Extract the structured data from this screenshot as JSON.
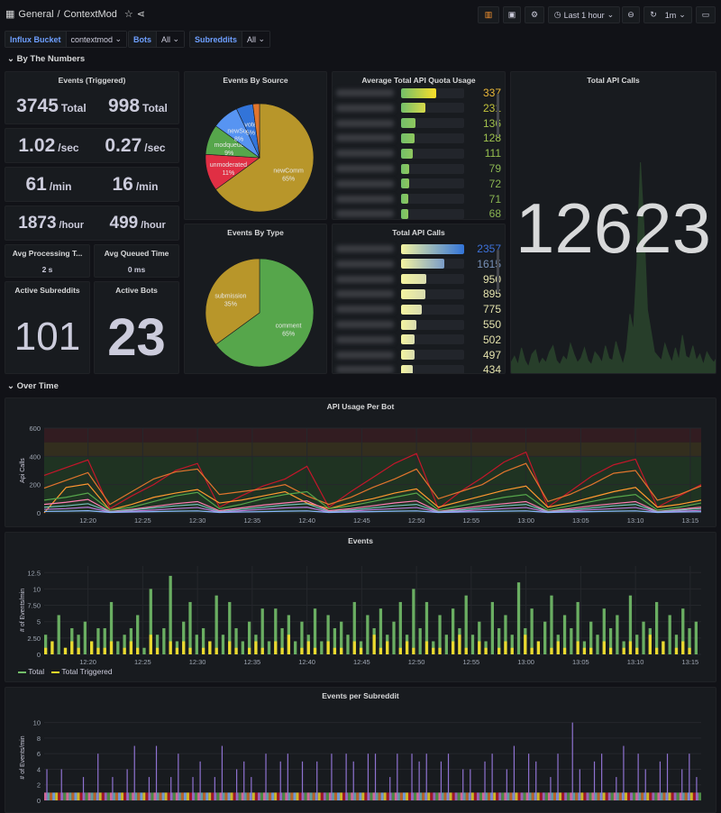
{
  "header": {
    "breadcrumb_folder": "General",
    "breadcrumb_sep": "/",
    "dashboard_title": "ContextMod",
    "time_range": "Last 1 hour",
    "refresh": "1m",
    "icons": [
      "apps-icon",
      "star-icon",
      "share-icon",
      "add-panel-icon",
      "save-icon",
      "settings-icon",
      "clock-icon",
      "zoom-out-icon",
      "refresh-icon",
      "tv-mode-icon"
    ]
  },
  "variables": [
    {
      "label": "Influx Bucket",
      "value": "contextmod"
    },
    {
      "label": "Bots",
      "value": "All"
    },
    {
      "label": "Subreddits",
      "value": "All"
    }
  ],
  "rows": {
    "numbers": "By The Numbers",
    "over_time": "Over Time"
  },
  "stats": {
    "events_title": "Events (Triggered)",
    "lines": [
      {
        "a": "3745",
        "au": "Total",
        "b": "998",
        "bu": "Total"
      },
      {
        "a": "1.02",
        "au": "/sec",
        "b": "0.27",
        "bu": "/sec"
      },
      {
        "a": "61",
        "au": "/min",
        "b": "16",
        "bu": "/min"
      },
      {
        "a": "1873",
        "au": "/hour",
        "b": "499",
        "bu": "/hour"
      }
    ],
    "avg_processing": {
      "title": "Avg Processing T...",
      "value": "2 s"
    },
    "avg_queued": {
      "title": "Avg Queued Time",
      "value": "0 ms"
    },
    "active_subreddits": {
      "title": "Active Subreddits",
      "value": "101"
    },
    "active_bots": {
      "title": "Active Bots",
      "value": "23"
    },
    "total_api": {
      "title": "Total API Calls",
      "value": "12623",
      "color": "#56a64b"
    }
  },
  "chart_data": [
    {
      "id": "events_by_source",
      "type": "pie",
      "title": "Events By Source",
      "slices": [
        {
          "label": "newComm",
          "value": 65,
          "color": "#b8962a"
        },
        {
          "label": "unmoderated",
          "value": 11,
          "color": "#e02f44"
        },
        {
          "label": "modqueue",
          "value": 9,
          "color": "#56a64b"
        },
        {
          "label": "newSub",
          "value": 8,
          "color": "#5794f2"
        },
        {
          "label": "vote",
          "value": 5,
          "color": "#3274d9"
        },
        {
          "label": "",
          "value": 2,
          "color": "#e0752d"
        }
      ]
    },
    {
      "id": "events_by_type",
      "type": "pie",
      "title": "Events By Type",
      "slices": [
        {
          "label": "comment",
          "value": 65,
          "color": "#56a64b"
        },
        {
          "label": "submission",
          "value": 35,
          "color": "#b8962a"
        }
      ]
    },
    {
      "id": "avg_quota",
      "type": "bar",
      "title": "Average Total API Quota Usage",
      "max": 600,
      "values": [
        337,
        231,
        136,
        128,
        111,
        79,
        72,
        71,
        68
      ],
      "value_colors": [
        "#eab839",
        "#c3c33b",
        "#a3c24d",
        "#9fc24f",
        "#96c04f",
        "#8ab552",
        "#8ab552",
        "#8ab552",
        "#8ab552"
      ]
    },
    {
      "id": "total_api_calls_bars",
      "type": "bar",
      "title": "Total API Calls",
      "max": 2357,
      "values": [
        2357,
        1615,
        950,
        895,
        775,
        550,
        502,
        497,
        434
      ],
      "value_colors": [
        "#3d71d9",
        "#7891b8",
        "#e5e3ad",
        "#e5e3ad",
        "#e5e3ad",
        "#e5e3ad",
        "#e5e3ad",
        "#e5e3ad",
        "#e5e3ad"
      ]
    },
    {
      "id": "total_api_spark",
      "type": "area",
      "values": [
        50,
        80,
        40,
        120,
        60,
        30,
        90,
        110,
        40,
        70,
        50,
        100,
        130,
        60,
        40,
        80,
        60,
        140,
        90,
        50,
        70,
        120,
        60,
        40,
        100,
        80,
        50,
        130,
        70,
        60,
        150,
        90,
        40,
        110,
        280,
        200,
        520,
        1000,
        700,
        300,
        200,
        100,
        80,
        60,
        140,
        90,
        50,
        120,
        60,
        180,
        80,
        70,
        130,
        60,
        90,
        40,
        100,
        70,
        50,
        80
      ]
    },
    {
      "id": "api_usage",
      "type": "line",
      "title": "API Usage Per Bot",
      "ylabel": "Api Calls",
      "ylim": [
        0,
        600
      ],
      "yticks": [
        0,
        200,
        400,
        600
      ],
      "x_start": "12:16",
      "x_end": "13:16",
      "xticks": [
        "12:20",
        "12:25",
        "12:30",
        "12:35",
        "12:40",
        "12:45",
        "12:50",
        "12:55",
        "13:00",
        "13:05",
        "13:10",
        "13:15"
      ],
      "thresholds": [
        {
          "from": 0,
          "to": 400,
          "color": "#1f3322"
        },
        {
          "from": 400,
          "to": 500,
          "color": "#332e1e"
        },
        {
          "from": 500,
          "to": 600,
          "color": "#321c21"
        }
      ],
      "series": [
        {
          "color": "#c4162a",
          "values": [
            265,
            320,
            375,
            30,
            120,
            200,
            300,
            350,
            40,
            120,
            190,
            240,
            330,
            40,
            150,
            250,
            350,
            420,
            30,
            150,
            250,
            360,
            430,
            40,
            150,
            260,
            340,
            380,
            40,
            120,
            200
          ]
        },
        {
          "color": "#e0752d",
          "values": [
            175,
            230,
            285,
            60,
            150,
            240,
            290,
            310,
            130,
            150,
            170,
            200,
            120,
            60,
            110,
            180,
            240,
            310,
            100,
            150,
            200,
            290,
            350,
            80,
            130,
            200,
            280,
            300,
            90,
            130,
            190
          ]
        },
        {
          "color": "#ff9830",
          "values": [
            0,
            180,
            205,
            20,
            60,
            110,
            140,
            165,
            70,
            90,
            120,
            150,
            70,
            30,
            70,
            100,
            140,
            170,
            40,
            80,
            120,
            160,
            190,
            40,
            70,
            110,
            150,
            180,
            40,
            60,
            90
          ]
        },
        {
          "color": "#56a64b",
          "values": [
            90,
            110,
            140,
            20,
            40,
            80,
            120,
            145,
            30,
            60,
            100,
            130,
            150,
            30,
            50,
            80,
            110,
            140,
            20,
            50,
            80,
            110,
            130,
            20,
            50,
            80,
            110,
            130,
            20,
            40,
            70
          ]
        },
        {
          "color": "#ff7eb3",
          "values": [
            60,
            75,
            95,
            10,
            25,
            45,
            65,
            80,
            15,
            35,
            55,
            70,
            85,
            15,
            30,
            50,
            70,
            85,
            10,
            30,
            50,
            65,
            80,
            10,
            30,
            50,
            65,
            80,
            10,
            25,
            40
          ]
        },
        {
          "color": "#73bfb8",
          "values": [
            40,
            50,
            65,
            8,
            20,
            35,
            50,
            60,
            8,
            25,
            40,
            55,
            65,
            8,
            20,
            35,
            50,
            60,
            8,
            20,
            35,
            50,
            60,
            8,
            20,
            35,
            50,
            60,
            8,
            20,
            30
          ]
        },
        {
          "color": "#b877d9",
          "values": [
            25,
            30,
            40,
            5,
            12,
            20,
            30,
            38,
            5,
            15,
            25,
            35,
            40,
            5,
            12,
            22,
            30,
            38,
            5,
            12,
            22,
            30,
            38,
            5,
            12,
            22,
            30,
            38,
            5,
            12,
            18
          ]
        },
        {
          "color": "#8ab8ff",
          "values": [
            10,
            12,
            15,
            3,
            6,
            9,
            12,
            14,
            3,
            6,
            9,
            12,
            14,
            3,
            6,
            9,
            12,
            14,
            3,
            6,
            9,
            12,
            14,
            3,
            6,
            9,
            12,
            14,
            3,
            6,
            8
          ]
        }
      ]
    },
    {
      "id": "events",
      "type": "bar",
      "title": "Events",
      "ylabel": "# of Events/min",
      "ylim": [
        0,
        13.5
      ],
      "yticks": [
        0,
        2.5,
        5,
        7.5,
        10,
        12.5
      ],
      "ytick_labels": [
        "0",
        "2.50",
        "5",
        "7.50",
        "10",
        "12.5"
      ],
      "x_start": "12:16",
      "x_end": "13:16",
      "xticks": [
        "12:20",
        "12:25",
        "12:30",
        "12:35",
        "12:40",
        "12:45",
        "12:50",
        "12:55",
        "13:00",
        "13:05",
        "13:10",
        "13:15"
      ],
      "series": [
        {
          "name": "Total",
          "color": "#73bf69",
          "values": [
            3,
            2,
            6,
            1,
            4,
            3,
            5,
            2,
            4,
            4,
            8,
            2,
            3,
            4,
            6,
            1,
            10,
            3,
            4,
            12,
            2,
            5,
            8,
            3,
            4,
            2,
            9,
            3,
            8,
            4,
            2,
            5,
            3,
            7,
            2,
            7,
            4,
            6,
            2,
            5,
            3,
            7,
            2,
            6,
            4,
            5,
            3,
            8,
            2,
            6,
            4,
            7,
            3,
            5,
            8,
            3,
            10,
            4,
            8,
            2,
            6,
            3,
            7,
            4,
            9,
            3,
            5,
            2,
            8,
            4,
            6,
            3,
            11,
            4,
            7,
            2,
            5,
            9,
            3,
            6,
            4,
            8,
            2,
            5,
            3,
            7,
            4,
            6,
            2,
            9,
            3,
            5,
            4,
            8,
            2,
            6,
            3,
            7,
            4,
            5
          ]
        },
        {
          "name": "Total Triggered",
          "color": "#fade2a",
          "values": [
            1,
            2,
            0,
            1,
            2,
            1,
            0,
            2,
            1,
            1,
            2,
            0,
            1,
            2,
            1,
            0,
            3,
            1,
            0,
            2,
            1,
            2,
            1,
            0,
            1,
            2,
            1,
            0,
            2,
            1,
            0,
            1,
            2,
            1,
            0,
            2,
            1,
            3,
            0,
            1,
            2,
            1,
            0,
            2,
            1,
            1,
            0,
            2,
            1,
            0,
            3,
            1,
            2,
            0,
            1,
            2,
            1,
            0,
            2,
            1,
            1,
            0,
            2,
            3,
            1,
            0,
            2,
            1,
            0,
            1,
            2,
            1,
            0,
            3,
            1,
            2,
            0,
            1,
            2,
            1,
            0,
            2,
            1,
            1,
            0,
            2,
            1,
            0,
            1,
            2,
            1,
            0,
            3,
            1,
            2,
            0,
            1,
            2,
            1,
            0
          ]
        }
      ]
    },
    {
      "id": "events_per_subreddit",
      "type": "bar",
      "title": "Events per Subreddit",
      "ylabel": "# of Events/min",
      "ylim": [
        0,
        11
      ],
      "yticks": [
        0,
        2,
        4,
        6,
        8,
        10
      ],
      "series": [
        {
          "color": "#8f72d1",
          "values": [
            4,
            0,
            4,
            0,
            0,
            3,
            0,
            6,
            0,
            3,
            0,
            4,
            7,
            0,
            3,
            7,
            0,
            3,
            6,
            0,
            3,
            5,
            0,
            3,
            7,
            0,
            4,
            5,
            3,
            0,
            6,
            0,
            5,
            6,
            0,
            5,
            0,
            5,
            0,
            6,
            0,
            6,
            5,
            0,
            6,
            6,
            0,
            3,
            6,
            0,
            6,
            5,
            6,
            0,
            5,
            6,
            0,
            4,
            4,
            0,
            5,
            6,
            0,
            4,
            7,
            0,
            6,
            5,
            0,
            3,
            6,
            0,
            10,
            4,
            0,
            5,
            6,
            0,
            3,
            7,
            0,
            6,
            4,
            0,
            5,
            6,
            0,
            4,
            6,
            3
          ]
        },
        {
          "color": "mixed",
          "values": [
            1,
            1,
            1,
            1,
            1,
            1,
            1,
            1,
            1,
            1
          ]
        }
      ]
    }
  ]
}
